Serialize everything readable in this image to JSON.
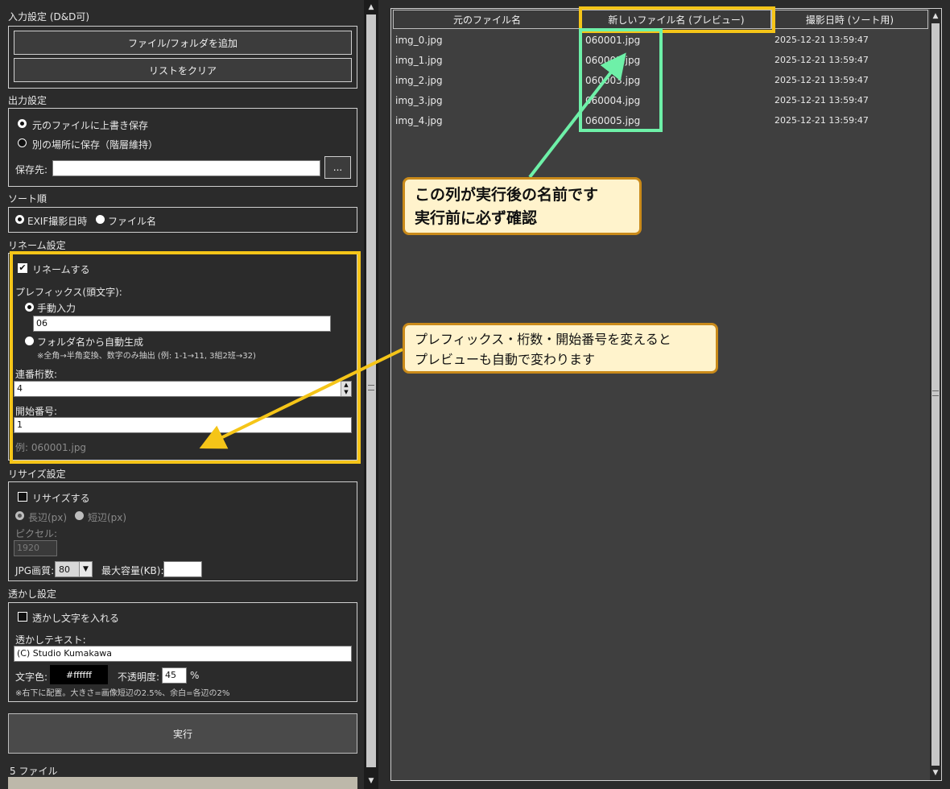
{
  "colors": {
    "highlight_yellow": "#f5c518",
    "highlight_green": "#6ef0a8",
    "callout_bg": "#fff3cc",
    "callout_border": "#c98a1a"
  },
  "input_section": {
    "title": "入力設定 (D&D可)",
    "add_button": "ファイル/フォルダを追加",
    "clear_button": "リストをクリア"
  },
  "output_section": {
    "title": "出力設定",
    "option_overwrite": "元のファイルに上書き保存",
    "option_other": "別の場所に保存（階層維持）",
    "dest_label": "保存先:",
    "dest_value": "",
    "browse_button": "..."
  },
  "sort_section": {
    "title": "ソート順",
    "option_exif": "EXIF撮影日時",
    "option_filename": "ファイル名"
  },
  "rename_section": {
    "title": "リネーム設定",
    "enable_label": "リネームする",
    "prefix_label": "プレフィックス(頭文字):",
    "manual_label": "手動入力",
    "manual_value": "06",
    "folder_label": "フォルダ名から自動生成",
    "folder_note": "※全角→半角変換、数字のみ抽出 (例: 1-1→11, 3組2班→32)",
    "digits_label": "連番桁数:",
    "digits_value": "4",
    "start_label": "開始番号:",
    "start_value": "1",
    "example": "例: 060001.jpg"
  },
  "resize_section": {
    "title": "リサイズ設定",
    "enable_label": "リサイズする",
    "long_side": "長辺(px)",
    "short_side": "短辺(px)",
    "pixel_label": "ピクセル:",
    "pixel_value": "1920",
    "quality_label": "JPG画質:",
    "quality_value": "80",
    "max_size_label": "最大容量(KB):",
    "max_size_value": ""
  },
  "watermark_section": {
    "title": "透かし設定",
    "enable_label": "透かし文字を入れる",
    "text_label": "透かしテキスト:",
    "text_value": "(C) Studio Kumakawa",
    "color_label": "文字色:",
    "color_value": "#ffffff",
    "opacity_label": "不透明度:",
    "opacity_value": "45",
    "percent": "%",
    "note": "※右下に配置。大きさ=画像短辺の2.5%、余白=各辺の2%"
  },
  "run_button": "実行",
  "file_count": "5 ファイル",
  "table": {
    "headers": [
      "元のファイル名",
      "新しいファイル名 (プレビュー)",
      "撮影日時 (ソート用)"
    ],
    "rows": [
      [
        "img_0.jpg",
        "060001.jpg",
        "2025-12-21 13:59:47"
      ],
      [
        "img_1.jpg",
        "060002.jpg",
        "2025-12-21 13:59:47"
      ],
      [
        "img_2.jpg",
        "060003.jpg",
        "2025-12-21 13:59:47"
      ],
      [
        "img_3.jpg",
        "060004.jpg",
        "2025-12-21 13:59:47"
      ],
      [
        "img_4.jpg",
        "060005.jpg",
        "2025-12-21 13:59:47"
      ]
    ]
  },
  "callouts": {
    "name_column_line1": "この列が実行後の名前です",
    "name_column_line2": "実行前に必ず確認",
    "prefix_line1": "プレフィックス・桁数・開始番号を変えると",
    "prefix_line2": "プレビューも自動で変わります"
  }
}
